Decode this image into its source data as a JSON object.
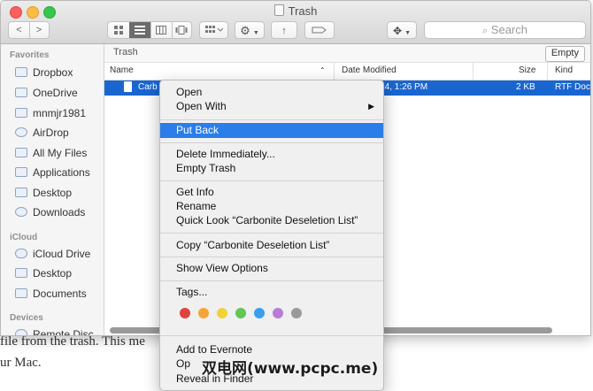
{
  "window": {
    "title": "Trash"
  },
  "toolbar": {
    "back": "<",
    "forward": ">",
    "gear": "⚙",
    "share": "↑",
    "dropbox": "✥",
    "search_placeholder": "Search"
  },
  "sidebar": {
    "favorites_header": "Favorites",
    "favorites": [
      "Dropbox",
      "OneDrive",
      "mnmjr1981",
      "AirDrop",
      "All My Files",
      "Applications",
      "Desktop",
      "Downloads"
    ],
    "icloud_header": "iCloud",
    "icloud": [
      "iCloud Drive",
      "Desktop",
      "Documents"
    ],
    "devices_header": "Devices",
    "devices": [
      "Remote Disc"
    ]
  },
  "path": {
    "label": "Trash",
    "empty_button": "Empty"
  },
  "columns": {
    "name": "Name",
    "date": "Date Modified",
    "size": "Size",
    "kind": "Kind"
  },
  "row": {
    "name": "Carb",
    "date": "2014, 1:26 PM",
    "size": "2 KB",
    "kind": "RTF Doc"
  },
  "menu": {
    "open": "Open",
    "open_with": "Open With",
    "put_back": "Put Back",
    "delete_immediately": "Delete Immediately...",
    "empty_trash": "Empty Trash",
    "get_info": "Get Info",
    "rename": "Rename",
    "quick_look": "Quick Look “Carbonite Deseletion List”",
    "copy": "Copy “Carbonite Deseletion List”",
    "show_view_options": "Show View Options",
    "tags": "Tags...",
    "add_to_evernote": "Add to Evernote",
    "open_partial": "Op",
    "reveal_in_finder": "Reveal in Finder"
  },
  "tag_colors": [
    "#e0443e",
    "#f5a535",
    "#f0d33b",
    "#62c554",
    "#3a9ef0",
    "#b87cd8",
    "#9a9a9a"
  ],
  "article": {
    "line1": "file from the trash. This me",
    "line2": "ur Mac."
  },
  "watermark": "双电网(www.pcpc.me)"
}
